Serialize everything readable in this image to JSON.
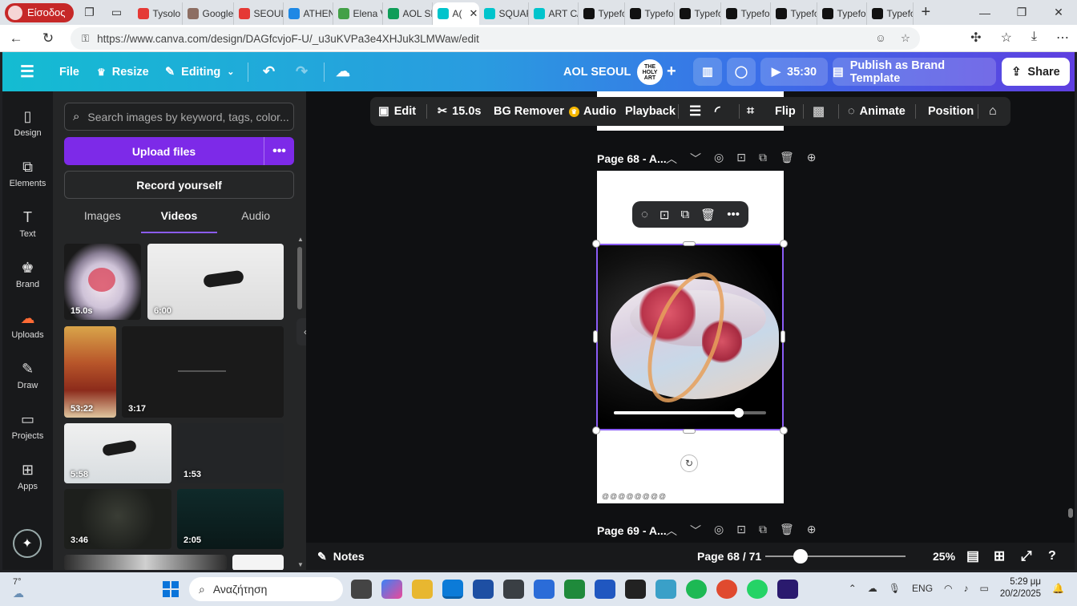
{
  "browser": {
    "profile_label": "Είσοδος",
    "tabs": [
      {
        "label": "Tysolo",
        "color": "#e53935"
      },
      {
        "label": "Google",
        "color": "#8d6e63"
      },
      {
        "label": "SEOUL",
        "color": "#e53935"
      },
      {
        "label": "ATHEN",
        "color": "#1e88e5"
      },
      {
        "label": "Elena V",
        "color": "#43a047"
      },
      {
        "label": "AOL SE",
        "color": "#0f9d58"
      },
      {
        "label": "A(",
        "color": "#00c4cc",
        "active": true
      },
      {
        "label": "SQUAR",
        "color": "#00c4cc"
      },
      {
        "label": "ART C/",
        "color": "#00c4cc"
      },
      {
        "label": "Typefo",
        "color": "#111111"
      },
      {
        "label": "Typefo",
        "color": "#111111"
      },
      {
        "label": "Typefo",
        "color": "#111111"
      },
      {
        "label": "Typefo",
        "color": "#111111"
      },
      {
        "label": "Typefo",
        "color": "#111111"
      },
      {
        "label": "Typefo",
        "color": "#111111"
      },
      {
        "label": "Typefo",
        "color": "#111111"
      }
    ],
    "url": "https://www.canva.com/design/DAGfcvjoF-U/_u3uKVPa3e4XHJuk3LMWaw/edit"
  },
  "topbar": {
    "file": "File",
    "resize": "Resize",
    "editing": "Editing",
    "title": "AOL SEOUL",
    "avatar_text": "THE HOLY ART",
    "timer": "35:30",
    "publish": "Publish as Brand Template",
    "share": "Share"
  },
  "rail": [
    {
      "label": "Design",
      "icon": "design-icon",
      "glyph": "▯"
    },
    {
      "label": "Elements",
      "icon": "elements-icon",
      "glyph": "⧉"
    },
    {
      "label": "Text",
      "icon": "text-icon",
      "glyph": "T"
    },
    {
      "label": "Brand",
      "icon": "brand-icon",
      "glyph": "♚"
    },
    {
      "label": "Uploads",
      "icon": "uploads-icon",
      "glyph": "☁"
    },
    {
      "label": "Draw",
      "icon": "draw-icon",
      "glyph": "✎"
    },
    {
      "label": "Projects",
      "icon": "projects-icon",
      "glyph": "▭"
    },
    {
      "label": "Apps",
      "icon": "apps-icon",
      "glyph": "⊞"
    }
  ],
  "panel": {
    "search_placeholder": "Search images by keyword, tags, color...",
    "upload": "Upload files",
    "record": "Record yourself",
    "tabs": [
      "Images",
      "Videos",
      "Audio"
    ],
    "thumbs": [
      {
        "duration": "15.0s"
      },
      {
        "duration": "6:00"
      },
      {
        "duration": "53:22"
      },
      {
        "duration": "3:17"
      },
      {
        "duration": "5:58"
      },
      {
        "duration": "1:53"
      },
      {
        "duration": "3:46"
      },
      {
        "duration": "2:05"
      }
    ]
  },
  "context_toolbar": {
    "edit": "Edit",
    "duration": "15.0s",
    "bg_remover": "BG Remover",
    "audio": "Audio",
    "playback": "Playback",
    "flip": "Flip",
    "animate": "Animate",
    "position": "Position"
  },
  "pages": {
    "current_label": "Page 68 - A...",
    "next_label": "Page 69 - A...",
    "footer_text": "@@@@@@@@"
  },
  "video_progress": 0.82,
  "footer": {
    "notes": "Notes",
    "page_indicator": "Page 68 / 71",
    "zoom": "25%",
    "zoom_fraction": 0.25
  },
  "taskbar": {
    "weather": "7°",
    "search_placeholder": "Αναζήτηση",
    "lang": "ENG",
    "time": "5:29 μμ",
    "date": "20/2/2025"
  },
  "colors": {
    "accent_purple": "#7d2ae8",
    "canva_gradient_start": "#14bcd2",
    "canva_gradient_end": "#5f3fe0"
  }
}
